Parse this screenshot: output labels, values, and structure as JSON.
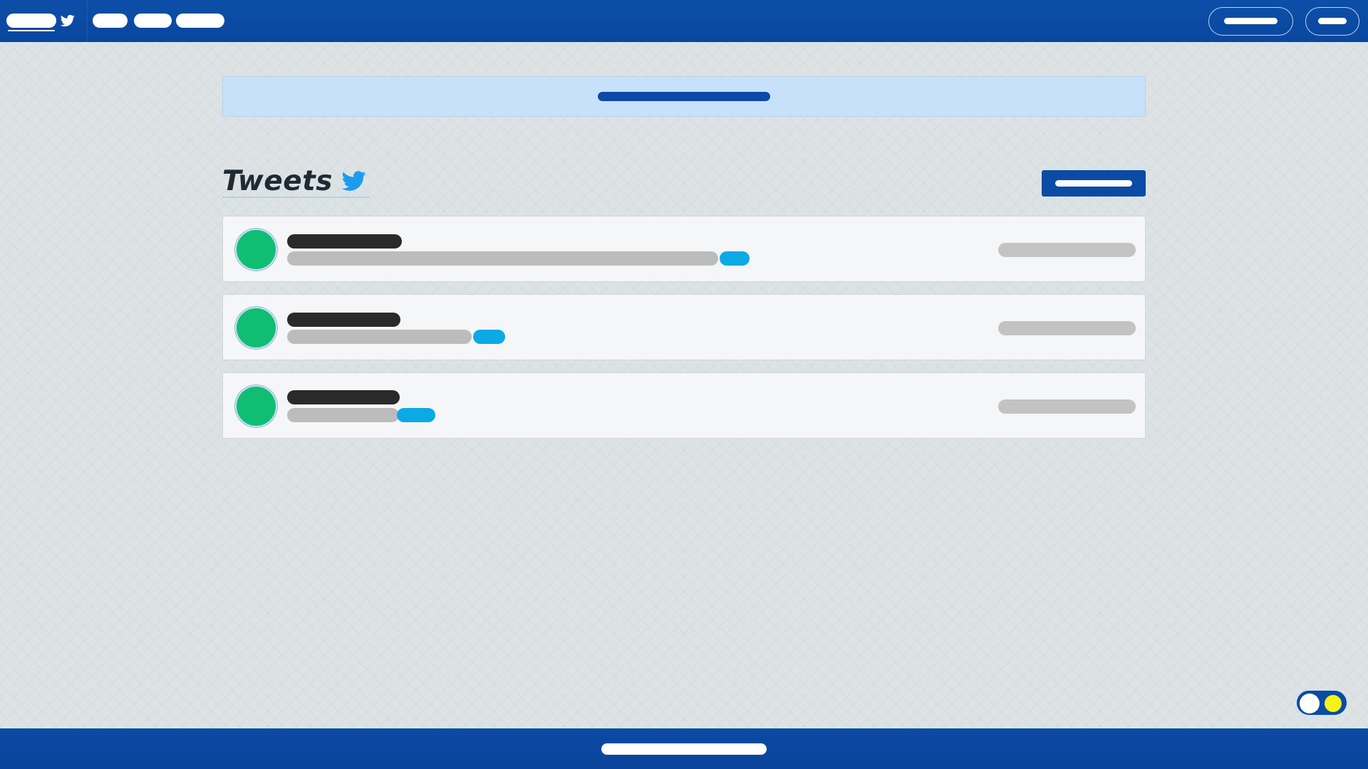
{
  "app": {
    "title": "Tweets"
  },
  "nav": {
    "brand": "",
    "links": [
      "",
      "",
      ""
    ],
    "signup_label": "",
    "login_label": ""
  },
  "banner": {
    "text": ""
  },
  "main": {
    "heading": "Tweets",
    "new_tweet_label": ""
  },
  "tweets": [
    {
      "author": "",
      "text": "",
      "hashtag": "",
      "timestamp": ""
    },
    {
      "author": "",
      "text": "",
      "hashtag": "",
      "timestamp": ""
    },
    {
      "author": "",
      "text": "",
      "hashtag": "",
      "timestamp": ""
    }
  ],
  "footer": {
    "text": ""
  },
  "icons": {
    "brand": "twitter-bird-icon",
    "heading": "twitter-bird-icon",
    "theme_toggle": "sun-icon"
  },
  "colors": {
    "nav_bg": "#0c4fa8",
    "accent": "#0b4aa5",
    "banner_bg": "#c8e1fb",
    "avatar": "#0fbd73",
    "hashtag": "#0ba9e6",
    "twitter_blue": "#1d9bf0",
    "sun": "#f5f21a"
  }
}
